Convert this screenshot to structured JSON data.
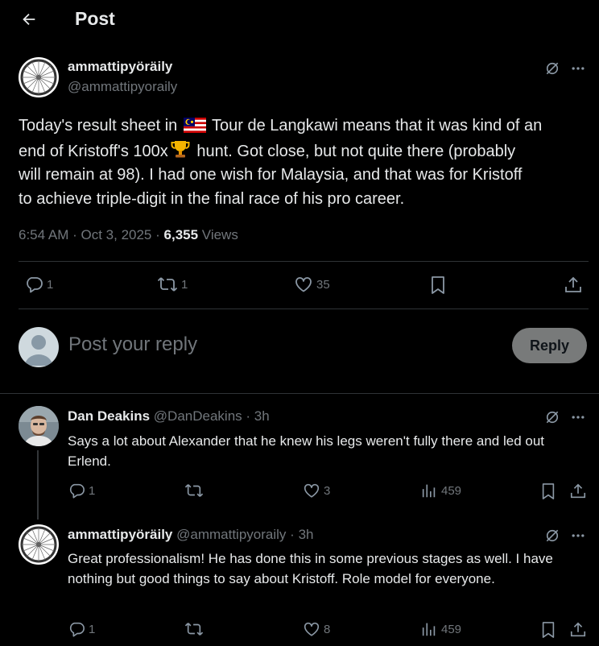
{
  "header": {
    "title": "Post"
  },
  "post": {
    "author_name": "ammattipyöräily",
    "author_handle": "@ammattipyorail y",
    "text_parts": {
      "p1": "Today's result sheet in",
      "p2": "Tour de Langkawi means that it was kind of an",
      "p3": "end of Kristoff's 100x",
      "p4": "hunt. Got close, but not quite there (probably",
      "p5": "will remain at 98). I had one wish for Malaysia, and that was for Kristoff",
      "p6": "to achieve triple-digit in the final race of his pro career."
    },
    "time": "6:54 AM",
    "date": "Oct 3, 2025",
    "views_count": "6,355",
    "views_label": "Views",
    "replies": "1",
    "reposts": "1",
    "likes": "35"
  },
  "composer": {
    "placeholder": "Post your reply",
    "reply_label": "Reply"
  },
  "replies": [
    {
      "name": "Dan Deakins",
      "handle": "@DanDeakins",
      "sep": "·",
      "age": "3h",
      "text": "Says a lot about Alexander that he knew his legs weren't fully there and led out Erlend.",
      "replies": "1",
      "likes": "3",
      "views": "459"
    },
    {
      "name": "ammattipyöräily",
      "handle": "@ammattipyorail y",
      "sep": "·",
      "age": "3h",
      "text": "Great professionalism! He has done this in some previous stages as well. I have nothing but good things to say about Kristoff. Role model for everyone.",
      "replies": "1",
      "likes": "8",
      "views": "459"
    }
  ],
  "icons": [
    "back-arrow-icon",
    "grok-icon",
    "more-icon",
    "reply-icon",
    "repost-icon",
    "like-icon",
    "bookmark-icon",
    "share-icon",
    "views-icon",
    "malaysia-flag-icon",
    "trophy-icon"
  ]
}
